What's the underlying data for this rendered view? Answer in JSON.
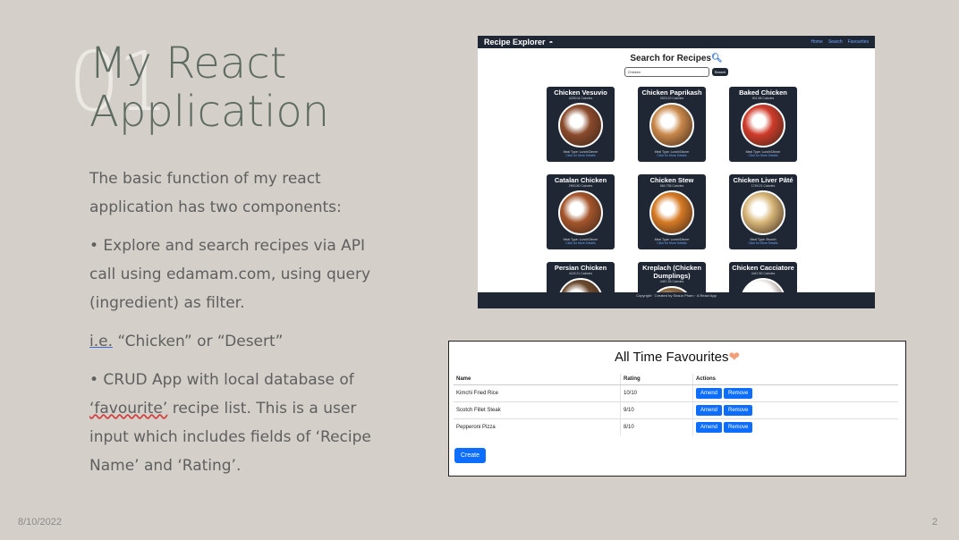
{
  "slide": {
    "number": "01",
    "title_line1": "My React",
    "title_line2": "Application",
    "para1": "The basic function of my react application has two components:",
    "bullet1": "• Explore and search recipes via API call using edamam.com, using query (ingredient) as filter.",
    "ie_label": "i.e.",
    "ie_rest": " “Chicken” or “Desert”",
    "bullet2_a": "• CRUD App with local database of ",
    "bullet2_word": "‘favourite’",
    "bullet2_b": " recipe list. This is a user input which includes fields of ‘Recipe Name’ and ‘Rating’.",
    "date": "8/10/2022",
    "page": "2"
  },
  "recipe_explorer": {
    "brand": "Recipe Explorer",
    "nav_links": [
      "Home",
      "Search",
      "Favourites"
    ],
    "search_title": "Search for Recipes",
    "search_value": "Chicken",
    "search_button": "Search",
    "cards": [
      {
        "title": "Chicken Vesuvio",
        "calories": "4228.04 Calories",
        "meal": "Meal Type: Lunch/Dinner",
        "link": "Click for More Details",
        "color": "#8a4a2c"
      },
      {
        "title": "Chicken Paprikash",
        "calories": "3023.20 Calories",
        "meal": "Meal Type: Lunch/Dinner",
        "link": "Click for More Details",
        "color": "#c9884a"
      },
      {
        "title": "Baked Chicken",
        "calories": "901.58 Calories",
        "meal": "Meal Type: Lunch/Dinner",
        "link": "Click for More Details",
        "color": "#cf3b2a"
      },
      {
        "title": "Catalan Chicken",
        "calories": "2900.80 Calories",
        "meal": "Meal Type: Lunch/Dinner",
        "link": "Click for More Details",
        "color": "#a4552b"
      },
      {
        "title": "Chicken Stew",
        "calories": "564.738 Calories",
        "meal": "Meal Type: Lunch/Dinner",
        "link": "Click for More Details",
        "color": "#d67a25"
      },
      {
        "title": "Chicken Liver Pâté",
        "calories": "1749.21 Calories",
        "meal": "Meal Type: Brunch",
        "link": "Click for More Details",
        "color": "#d8b779"
      },
      {
        "title": "Persian Chicken",
        "calories": "4115.21 Calories",
        "meal": "",
        "link": "",
        "color": "#6b4a2e"
      },
      {
        "title": "Kreplach (Chicken Dumplings)",
        "calories": "4467.26 Calories",
        "meal": "",
        "link": "",
        "color": "#8c6a42"
      },
      {
        "title": "Chicken Cacciatore",
        "calories": "4447.80 Calories",
        "meal": "",
        "link": "",
        "color": "#ffffff"
      }
    ],
    "footer": "Copyright · Created by Shaun Pham · A React App"
  },
  "favourites": {
    "title": "All Time Favourites",
    "columns": [
      "Name",
      "Rating",
      "Actions"
    ],
    "rows": [
      {
        "name": "Kimchi Fried Rice",
        "rating": "10/10"
      },
      {
        "name": "Scotch Fillet Steak",
        "rating": "9/10"
      },
      {
        "name": "Pepperoni Pizza",
        "rating": "8/10"
      }
    ],
    "amend_label": "Amend",
    "remove_label": "Remove",
    "create_label": "Create"
  }
}
